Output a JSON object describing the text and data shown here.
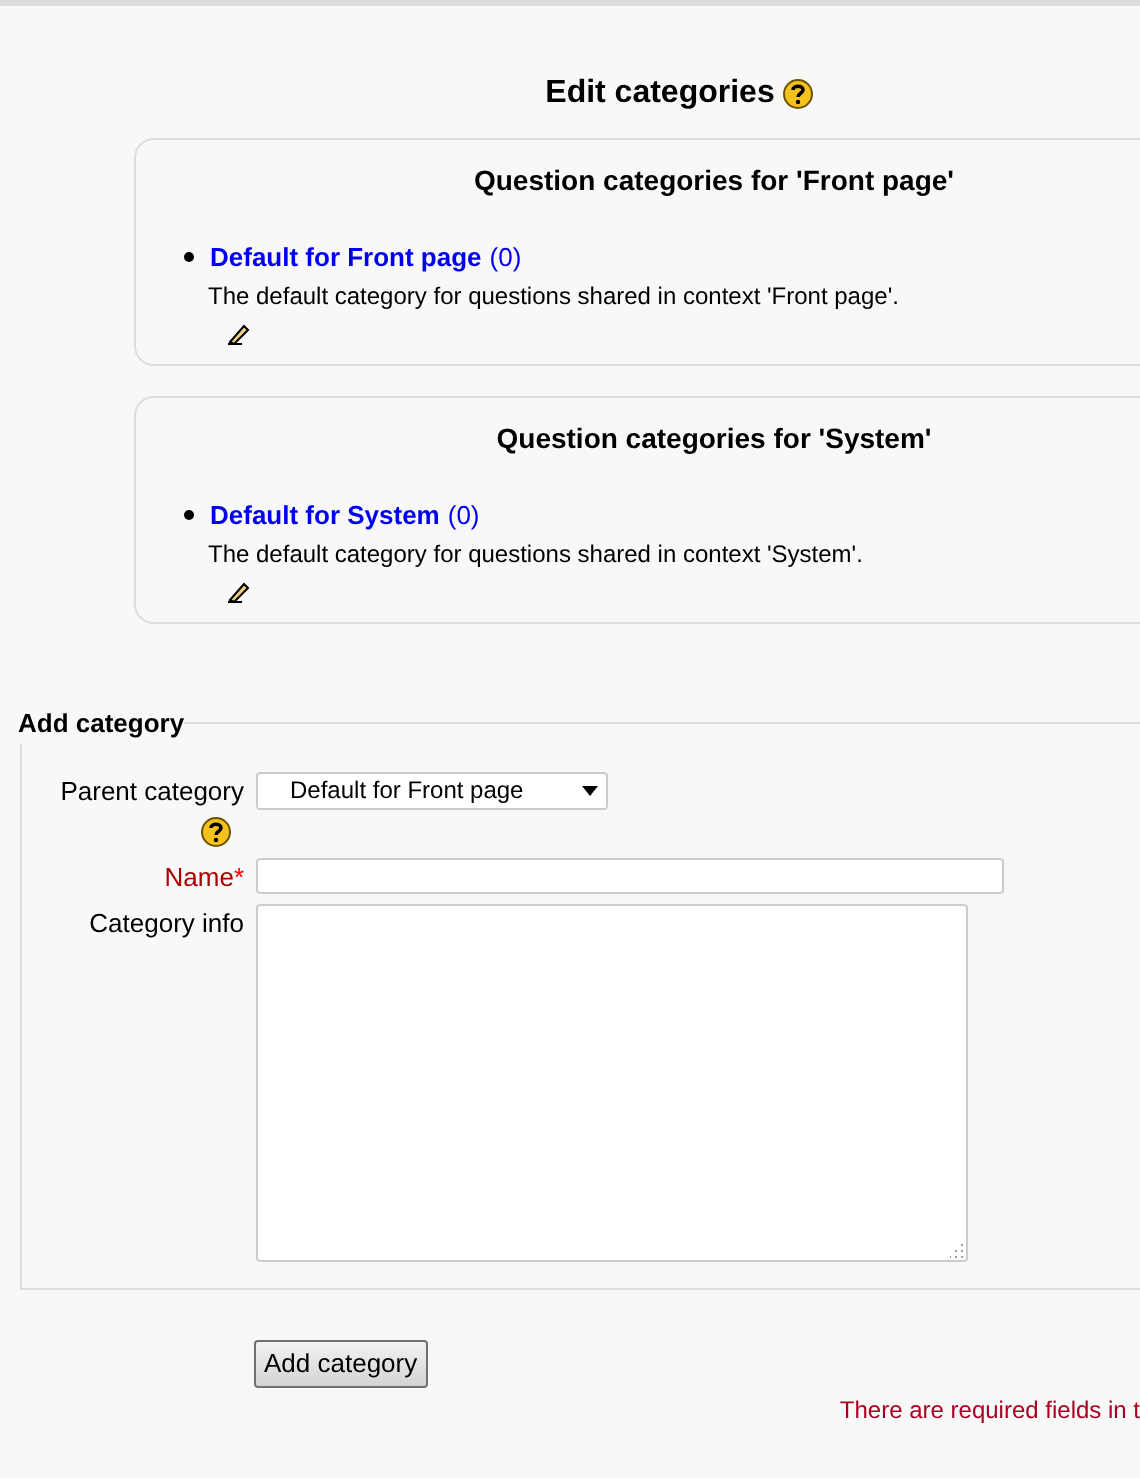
{
  "page_title": "Edit categories",
  "contexts": [
    {
      "heading": "Question categories for 'Front page'",
      "categories": [
        {
          "name": "Default for Front page",
          "count": "(0)",
          "description": "The default category for questions shared in context 'Front page'."
        }
      ]
    },
    {
      "heading": "Question categories for 'System'",
      "categories": [
        {
          "name": "Default for System",
          "count": "(0)",
          "description": "The default category for questions shared in context 'System'."
        }
      ]
    }
  ],
  "add_category": {
    "legend": "Add category",
    "required_marker": "*",
    "fields": [
      {
        "kind": "select",
        "label": "Parent category",
        "value": "Default for Front page",
        "help": true,
        "required": false
      },
      {
        "kind": "text",
        "label": "Name",
        "help": false,
        "required": true
      },
      {
        "kind": "textarea",
        "label": "Category info",
        "help": false,
        "required": false
      }
    ],
    "button": "Add category",
    "required_note": "There are required fields in t"
  }
}
